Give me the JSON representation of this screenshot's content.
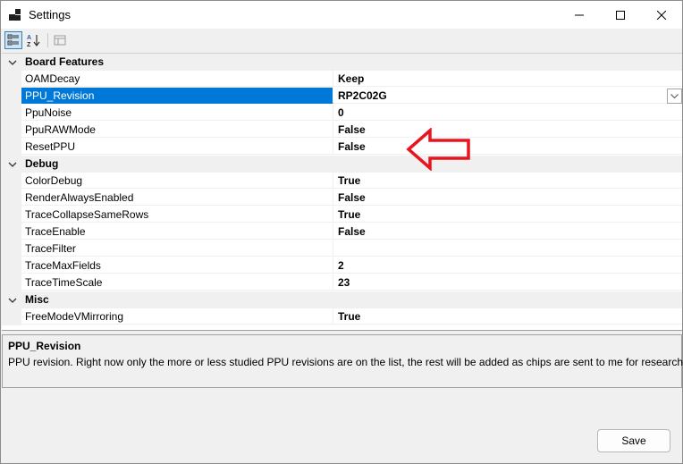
{
  "window": {
    "title": "Settings",
    "controls": [
      "minimize-icon",
      "maximize-icon",
      "close-icon"
    ]
  },
  "toolbar": {
    "buttons": [
      {
        "icon": "categorized-view-icon",
        "active": true
      },
      {
        "icon": "sort-alphabetical-icon",
        "active": false
      },
      {
        "icon": "property-pages-icon",
        "active": false,
        "enabled": false
      }
    ]
  },
  "grid": {
    "categories": [
      {
        "label": "Board Features",
        "expanded": true,
        "properties": [
          {
            "name": "OAMDecay",
            "value": "Keep"
          },
          {
            "name": "PPU_Revision",
            "value": "RP2C02G",
            "selected": true,
            "has_dropdown": true
          },
          {
            "name": "PpuNoise",
            "value": "0"
          },
          {
            "name": "PpuRAWMode",
            "value": "False"
          },
          {
            "name": "ResetPPU",
            "value": "False"
          }
        ]
      },
      {
        "label": "Debug",
        "expanded": true,
        "properties": [
          {
            "name": "ColorDebug",
            "value": "True"
          },
          {
            "name": "RenderAlwaysEnabled",
            "value": "False"
          },
          {
            "name": "TraceCollapseSameRows",
            "value": "True"
          },
          {
            "name": "TraceEnable",
            "value": "False"
          },
          {
            "name": "TraceFilter",
            "value": ""
          },
          {
            "name": "TraceMaxFields",
            "value": "2"
          },
          {
            "name": "TraceTimeScale",
            "value": "23"
          }
        ]
      },
      {
        "label": "Misc",
        "expanded": true,
        "properties": [
          {
            "name": "FreeModeVMirroring",
            "value": "True"
          }
        ]
      }
    ],
    "annotation": {
      "icon": "red-arrow-left-icon",
      "color": "#e8141e"
    }
  },
  "help": {
    "title": "PPU_Revision",
    "description": "PPU revision. Right now only the more or less studied PPU revisions are on the list, the rest will be added as chips are sent to me for research."
  },
  "footer": {
    "save_label": "Save"
  },
  "colors": {
    "selection": "#0078d7",
    "annotation": "#e8141e"
  }
}
